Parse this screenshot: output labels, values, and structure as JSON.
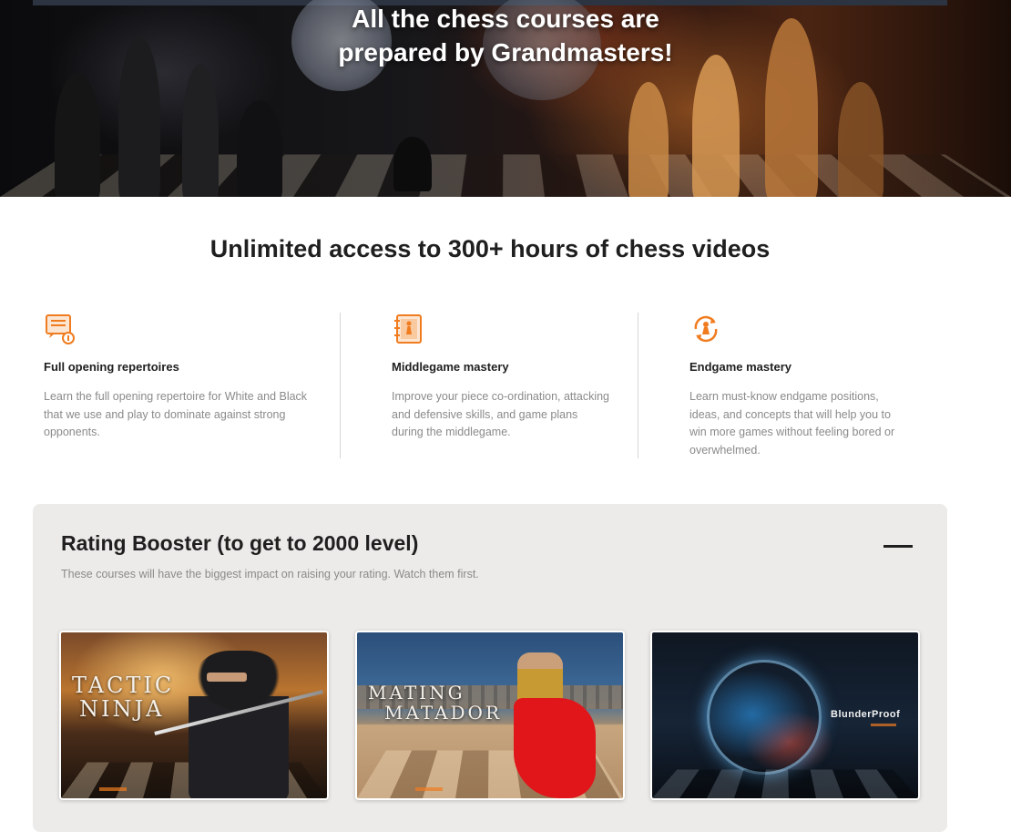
{
  "hero": {
    "title_line1": "All the chess courses are",
    "title_line2": "prepared by Grandmasters!"
  },
  "section": {
    "title": "Unlimited access to 300+ hours of chess videos"
  },
  "features": [
    {
      "icon": "opening-book-icon",
      "title": "Full opening repertoires",
      "text": "Learn the full opening repertoire for White and Black that we use and play to dominate against strong opponents."
    },
    {
      "icon": "notebook-pawn-icon",
      "title": "Middlegame mastery",
      "text": "Improve your piece co-ordination, attacking and defensive skills, and game plans during the middlegame."
    },
    {
      "icon": "cycle-pawn-icon",
      "title": "Endgame mastery",
      "text": "Learn must-know endgame positions, ideas, and concepts that will help you to win more games without feeling bored or overwhelmed."
    }
  ],
  "booster": {
    "title": "Rating Booster (to get to 2000 level)",
    "subtitle": "These courses will have the biggest impact on raising your rating. Watch them first.",
    "collapse_icon": "minus-icon",
    "courses": [
      {
        "title_line1": "TACTIC",
        "title_line2": "NINJA"
      },
      {
        "title_line1": "MATING",
        "title_line2": "MATADOR"
      },
      {
        "title": "BlunderProof"
      }
    ]
  },
  "colors": {
    "accent": "#f07c1f",
    "panel_bg": "#edebe9",
    "muted_text": "#8a8a8a",
    "heading": "#1f1f1f"
  }
}
